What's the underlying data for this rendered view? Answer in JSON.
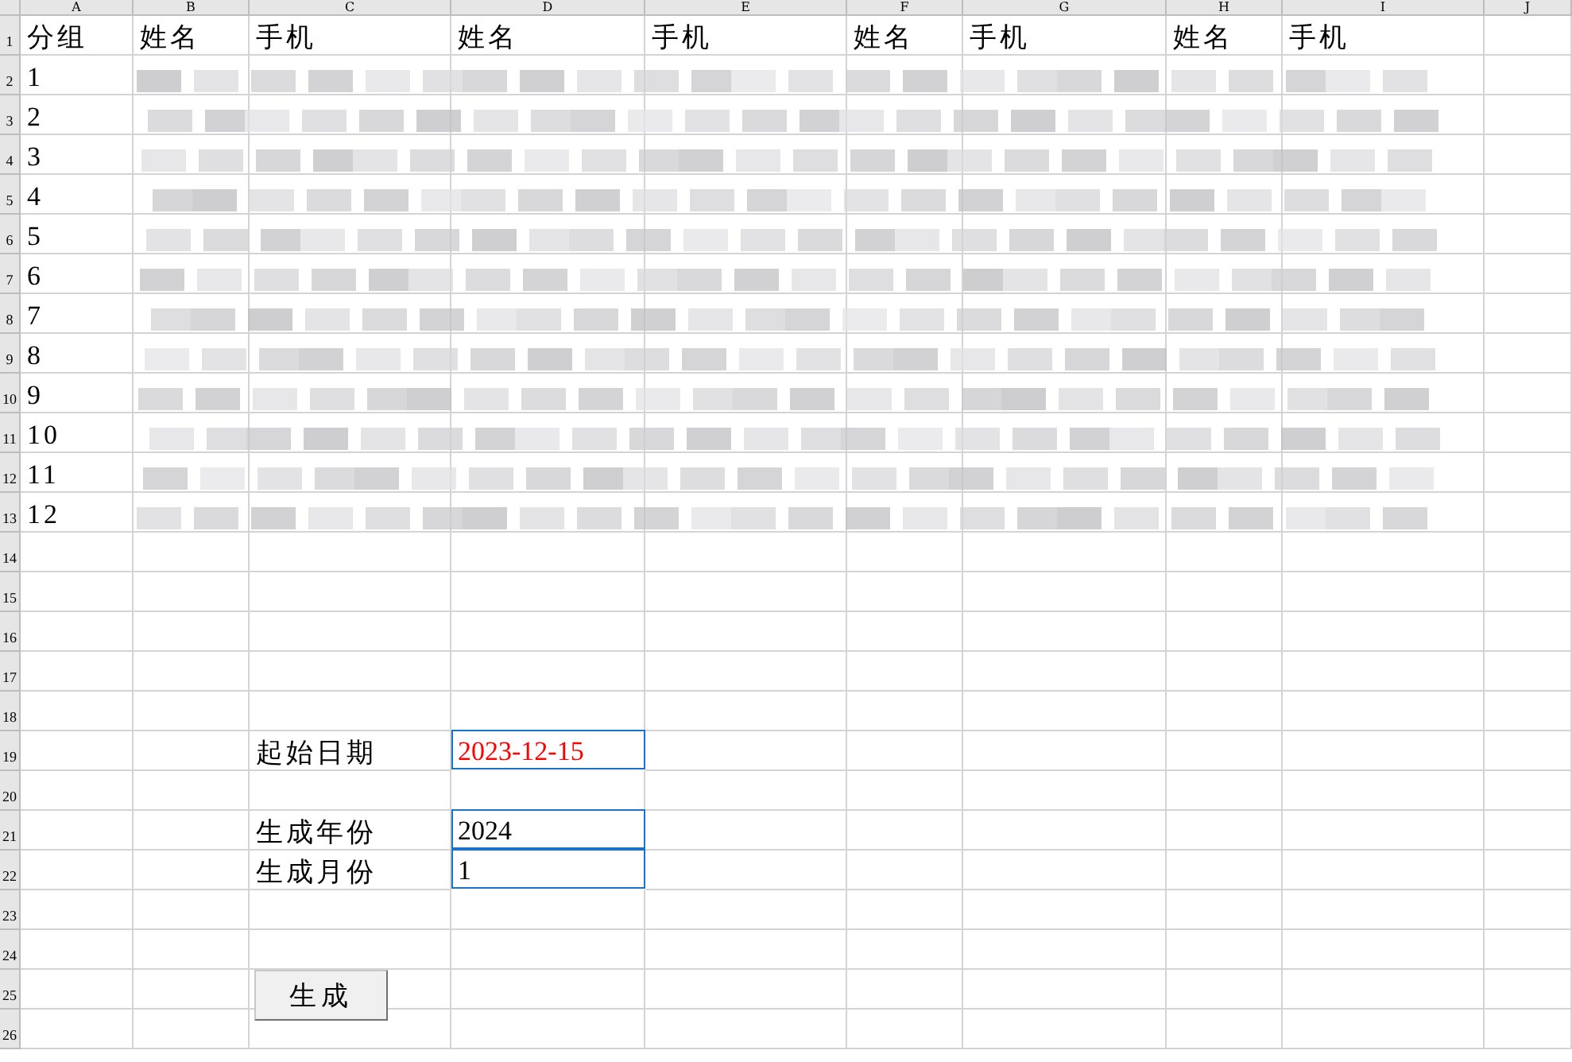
{
  "sheet": {
    "columns": [
      "A",
      "B",
      "C",
      "D",
      "E",
      "F",
      "G",
      "H",
      "I",
      "J"
    ],
    "rows": [
      {
        "number": "1",
        "cells": {
          "A": "分组",
          "B": "姓名",
          "C": "手机",
          "D": "姓名",
          "E": "手机",
          "F": "姓名",
          "G": "手机",
          "H": "姓名",
          "I": "手机"
        }
      },
      {
        "number": "2",
        "cells": {
          "A": "1"
        }
      },
      {
        "number": "3",
        "cells": {
          "A": "2"
        }
      },
      {
        "number": "4",
        "cells": {
          "A": "3"
        }
      },
      {
        "number": "5",
        "cells": {
          "A": "4"
        }
      },
      {
        "number": "6",
        "cells": {
          "A": "5"
        }
      },
      {
        "number": "7",
        "cells": {
          "A": "6"
        }
      },
      {
        "number": "8",
        "cells": {
          "A": "7"
        }
      },
      {
        "number": "9",
        "cells": {
          "A": "8"
        }
      },
      {
        "number": "10",
        "cells": {
          "A": "9"
        }
      },
      {
        "number": "11",
        "cells": {
          "A": "10"
        }
      },
      {
        "number": "12",
        "cells": {
          "A": "11"
        }
      },
      {
        "number": "13",
        "cells": {
          "A": "12"
        }
      },
      {
        "number": "14",
        "cells": {}
      },
      {
        "number": "15",
        "cells": {}
      },
      {
        "number": "16",
        "cells": {}
      },
      {
        "number": "17",
        "cells": {}
      },
      {
        "number": "18",
        "cells": {}
      },
      {
        "number": "19",
        "cells": {
          "C": "起始日期",
          "D": {
            "kind": "input",
            "text": "2023-12-15",
            "color": "#ff0000"
          }
        }
      },
      {
        "number": "20",
        "cells": {}
      },
      {
        "number": "21",
        "cells": {
          "C": "生成年份",
          "D": {
            "kind": "input",
            "text": "2024",
            "color": "#000000"
          }
        }
      },
      {
        "number": "22",
        "cells": {
          "C": "生成月份",
          "D": {
            "kind": "input",
            "text": "1",
            "color": "#000000"
          }
        }
      },
      {
        "number": "23",
        "cells": {}
      },
      {
        "number": "24",
        "cells": {}
      },
      {
        "number": "25",
        "cells": {}
      },
      {
        "number": "26",
        "cells": {}
      }
    ]
  },
  "button": {
    "label": "生成"
  }
}
